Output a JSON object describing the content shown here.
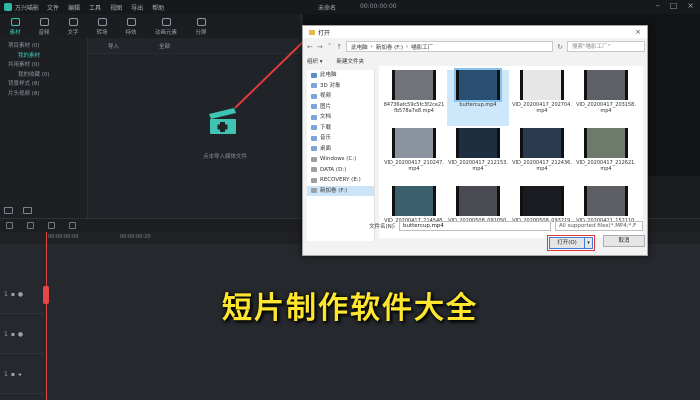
{
  "app": {
    "title": "万兴喵影",
    "menu": [
      "文件",
      "编辑",
      "工具",
      "视图",
      "导出",
      "帮助"
    ],
    "project_name": "未命名",
    "timecode": "00:00:00:00"
  },
  "toolbar": {
    "items": [
      {
        "label": "素材",
        "icon": "media-icon"
      },
      {
        "label": "音频",
        "icon": "audio-icon"
      },
      {
        "label": "文字",
        "icon": "text-icon"
      },
      {
        "label": "转场",
        "icon": "transition-icon"
      },
      {
        "label": "特效",
        "icon": "effects-icon"
      },
      {
        "label": "动画元素",
        "icon": "elements-icon"
      },
      {
        "label": "分屏",
        "icon": "splitscreen-icon"
      }
    ]
  },
  "library": {
    "items": [
      {
        "label": "项目素材 (0)",
        "sub": false,
        "selected": false
      },
      {
        "label": "我的素材",
        "sub": true,
        "selected": true
      },
      {
        "label": "共用素材 (0)",
        "sub": false,
        "selected": false
      },
      {
        "label": "我的收藏 (0)",
        "sub": true,
        "selected": false
      },
      {
        "label": "背景样式 (8)",
        "sub": false,
        "selected": false
      },
      {
        "label": "片头视频 (8)",
        "sub": false,
        "selected": false
      }
    ]
  },
  "media": {
    "import_label": "导入",
    "filter_label": "全部",
    "import_hint": "点击导入媒体文件"
  },
  "dialog": {
    "title": "打开",
    "breadcrumb": [
      "此电脑",
      "新加卷 (F:)",
      "喵影工厂"
    ],
    "search_placeholder": "搜索\"喵影工厂\"",
    "organize_label": "组织 ▾",
    "new_folder_label": "新建文件夹",
    "nav_items": [
      {
        "label": "此电脑",
        "type": "pc"
      },
      {
        "label": "3D 对象",
        "type": "folder"
      },
      {
        "label": "视频",
        "type": "folder"
      },
      {
        "label": "图片",
        "type": "folder"
      },
      {
        "label": "文档",
        "type": "folder"
      },
      {
        "label": "下载",
        "type": "folder"
      },
      {
        "label": "音乐",
        "type": "folder"
      },
      {
        "label": "桌面",
        "type": "folder"
      },
      {
        "label": "Windows (C:)",
        "type": "drive"
      },
      {
        "label": "DATA (D:)",
        "type": "drive"
      },
      {
        "label": "RECOVERY (E:)",
        "type": "drive"
      },
      {
        "label": "新加卷 (F:)",
        "type": "drive"
      }
    ],
    "files": [
      {
        "name": "84736afc59c5fc3f2ce21fb578a7e8.mp4",
        "selected": false
      },
      {
        "name": "buttercup.mp4",
        "selected": true
      },
      {
        "name": "VID_20200417_202704.mp4",
        "selected": false
      },
      {
        "name": "VID_20200417_203158.mp4",
        "selected": false
      },
      {
        "name": "VID_20200417_210247.mp4",
        "selected": false
      },
      {
        "name": "VID_20200417_212153.mp4",
        "selected": false
      },
      {
        "name": "VID_20200417_212436.mp4",
        "selected": false
      },
      {
        "name": "VID_20200417_212621.mp4",
        "selected": false
      },
      {
        "name": "VID_20200417_214548.mp4",
        "selected": false
      },
      {
        "name": "VID_20200508_091050.mp4",
        "selected": false
      },
      {
        "name": "VID_20200508_093219.mp4",
        "selected": false
      },
      {
        "name": "VID_20200421_152110.mp4",
        "selected": false
      }
    ],
    "filename_label": "文件名(N):",
    "filename_value": "buttercup.mp4",
    "filetype_value": "All supported files(*.MP4;*.F",
    "open_label": "打开(O)",
    "cancel_label": "取消"
  },
  "timeline": {
    "ruler_start": "00:00:00:00",
    "ruler_mark": "00:00:00:20",
    "tracks": [
      "1",
      "1",
      "1"
    ]
  },
  "banner": {
    "text": "短片制作软件大全"
  },
  "colors": {
    "accent": "#3cc6b6",
    "highlight": "#e03b3b",
    "banner": "#ffe62e"
  }
}
